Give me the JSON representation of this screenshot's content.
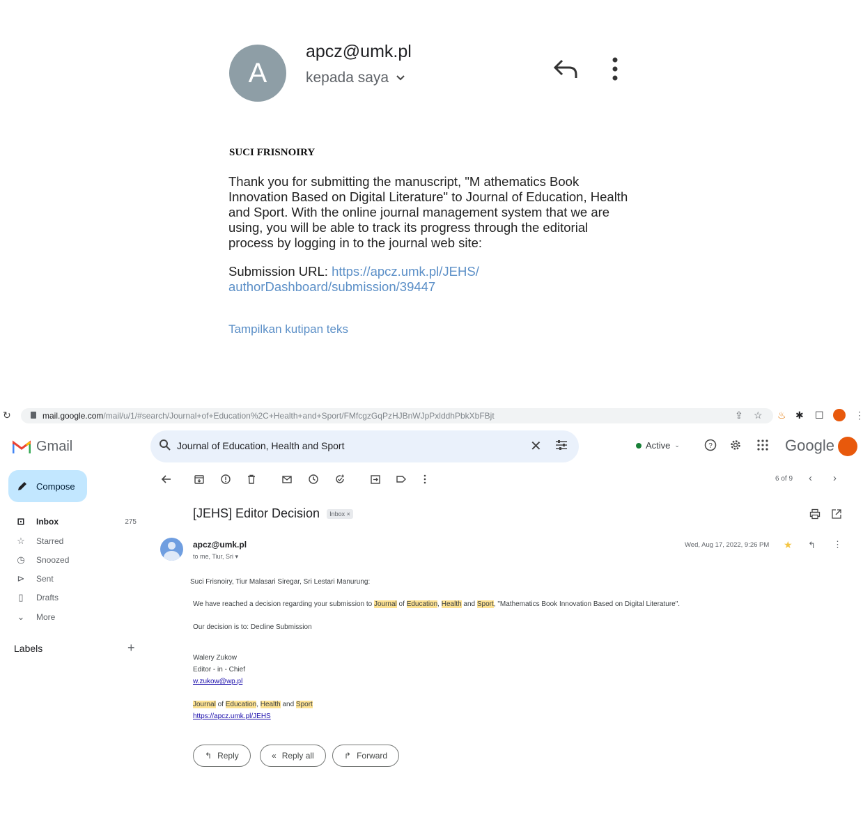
{
  "mobile": {
    "avatar_letter": "A",
    "sender": "apcz@umk.pl",
    "recipient": "kepada saya",
    "signature_name": "SUCI FRISNOIRY",
    "body": "Thank you for submitting the manuscript, \"M athematics Book Innovation Based on Digital Literature\" to Journal of Education, Health and Sport. With the online journal management system that we are using, you will be able to track its progress through the editorial process by logging in to the journal web site:",
    "url_label": "Submission URL: ",
    "url_link": "https://apcz.umk.pl/JEHS/ authorDashboard/submission/39447",
    "show_quote": "Tampilkan kutipan teks"
  },
  "browser": {
    "url_host": "mail.google.com",
    "url_path": "/mail/u/1/#search/Journal+of+Education%2C+Health+and+Sport/FMfcgzGqPzHJBnWJpPxlddhPbkXbFBjt"
  },
  "gmail": {
    "app_name": "Gmail",
    "search_query": "Journal of Education, Health and Sport",
    "status": "Active",
    "brand": "Google",
    "compose_label": "Compose",
    "nav": [
      {
        "label": "Inbox",
        "count": "275",
        "icon": "inbox-icon"
      },
      {
        "label": "Starred",
        "icon": "star-icon"
      },
      {
        "label": "Snoozed",
        "icon": "clock-icon"
      },
      {
        "label": "Sent",
        "icon": "send-icon"
      },
      {
        "label": "Drafts",
        "icon": "draft-icon"
      },
      {
        "label": "More",
        "icon": "chevron-down-icon"
      }
    ],
    "labels_heading": "Labels",
    "pager": "6 of 9",
    "subject": "[JEHS] Editor Decision",
    "subject_badge": "Inbox ×",
    "sender_name": "apcz@umk.pl",
    "sender_to": "to me, Tiur, Sri",
    "date": "Wed, Aug 17, 2022, 9:26 PM",
    "body": {
      "greeting": "Suci Frisnoiry, Tiur Malasari Siregar, Sri Lestari Manurung:",
      "line1_pre": "We have reached a decision regarding your submission to ",
      "w_journal": "Journal",
      "w_of": " of ",
      "w_education": "Education",
      "w_comma": ", ",
      "w_health": "Health",
      "w_and": " and ",
      "w_sport": "Sport",
      "line1_post": ", \"Mathematics Book Innovation Based on Digital Literature\".",
      "decision": "Our decision is to: Decline Submission",
      "editor_name": "Walery Zukow",
      "editor_title": "Editor - in - Chief",
      "editor_email": "w.zukow@wp.pl",
      "footer_url": "https://apcz.umk.pl/JEHS"
    },
    "actions": {
      "reply": "Reply",
      "reply_all": "Reply all",
      "forward": "Forward"
    },
    "colors": {
      "compose_bg": "#c2e7ff",
      "search_bg": "#eaf1fb",
      "highlight": "#fde293",
      "active_dot": "#188038"
    }
  }
}
